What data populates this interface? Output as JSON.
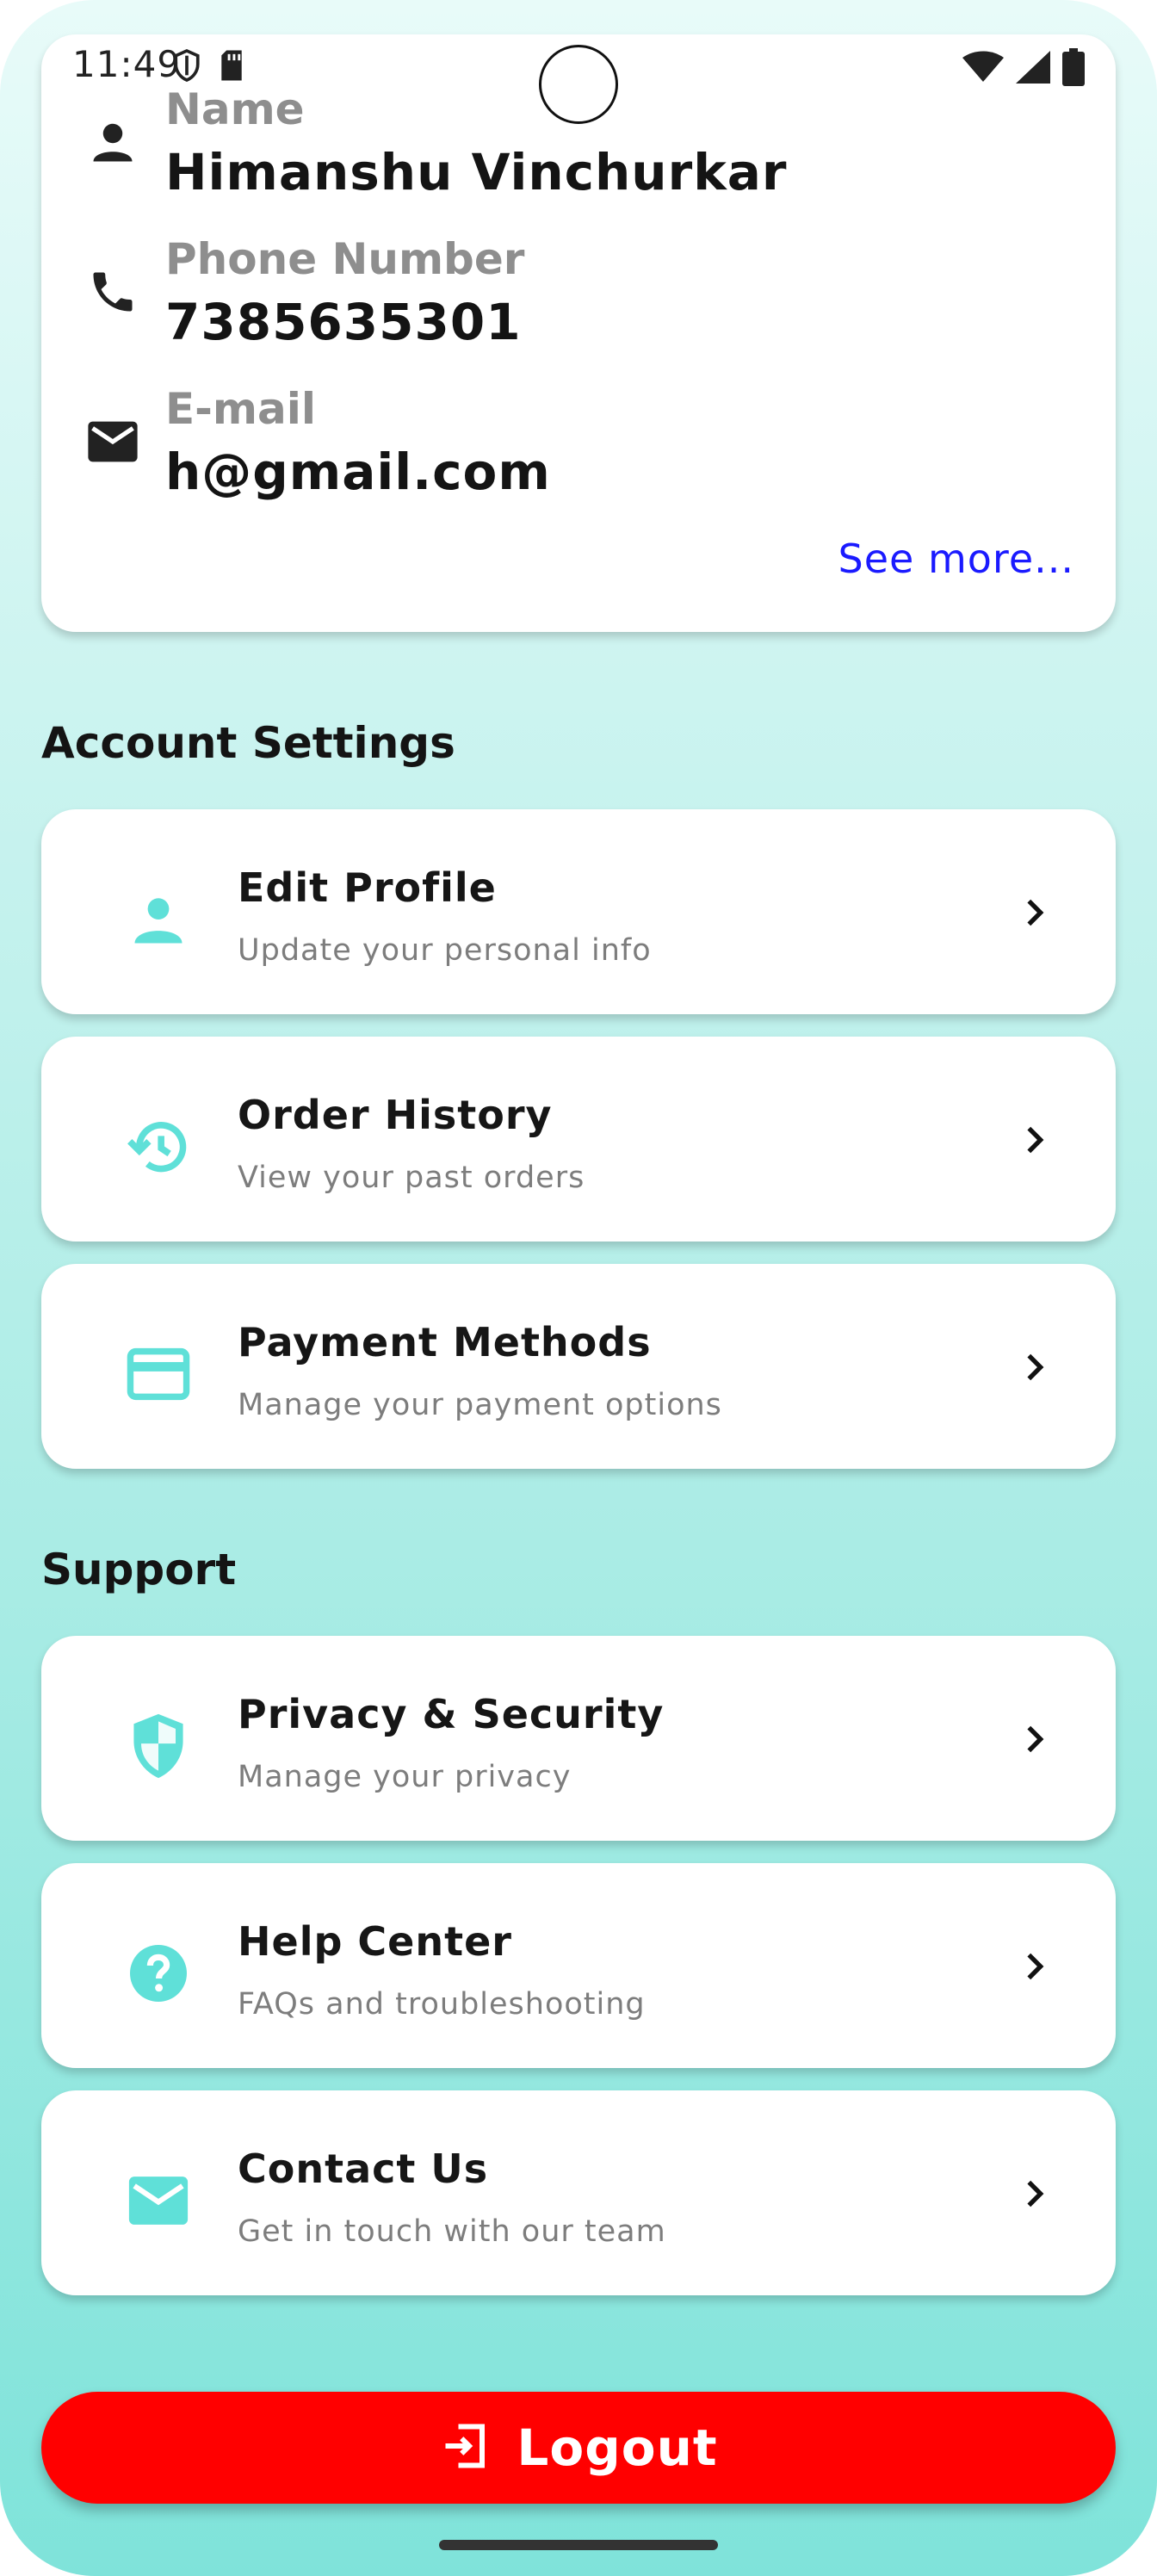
{
  "status_bar": {
    "time": "11:49",
    "left_icons": [
      "shield-outline-icon",
      "sd-card-icon"
    ],
    "right_icons": [
      "wifi-icon",
      "signal-icon",
      "battery-icon"
    ]
  },
  "profile": {
    "name_label": "Name",
    "name_value": "Himanshu Vinchurkar",
    "phone_label": "Phone Number",
    "phone_value": "7385635301",
    "email_label": "E-mail",
    "email_value": "h@gmail.com",
    "see_more": "See more..."
  },
  "account_settings": {
    "title": "Account Settings",
    "items": [
      {
        "title": "Edit Profile",
        "subtitle": "Update your personal info",
        "icon": "person-icon"
      },
      {
        "title": "Order History",
        "subtitle": "View your past orders",
        "icon": "history-icon"
      },
      {
        "title": "Payment Methods",
        "subtitle": "Manage your payment options",
        "icon": "credit-card-icon"
      }
    ]
  },
  "support": {
    "title": "Support",
    "items": [
      {
        "title": "Privacy & Security",
        "subtitle": "Manage your privacy",
        "icon": "shield-icon"
      },
      {
        "title": "Help Center",
        "subtitle": "FAQs and troubleshooting",
        "icon": "help-icon"
      },
      {
        "title": "Contact Us",
        "subtitle": "Get in touch with our team",
        "icon": "mail-icon"
      }
    ]
  },
  "logout": {
    "label": "Logout",
    "icon": "logout-icon"
  },
  "colors": {
    "accent": "#5fe0d8",
    "logout": "#ff0000",
    "link": "#1a1aff"
  }
}
